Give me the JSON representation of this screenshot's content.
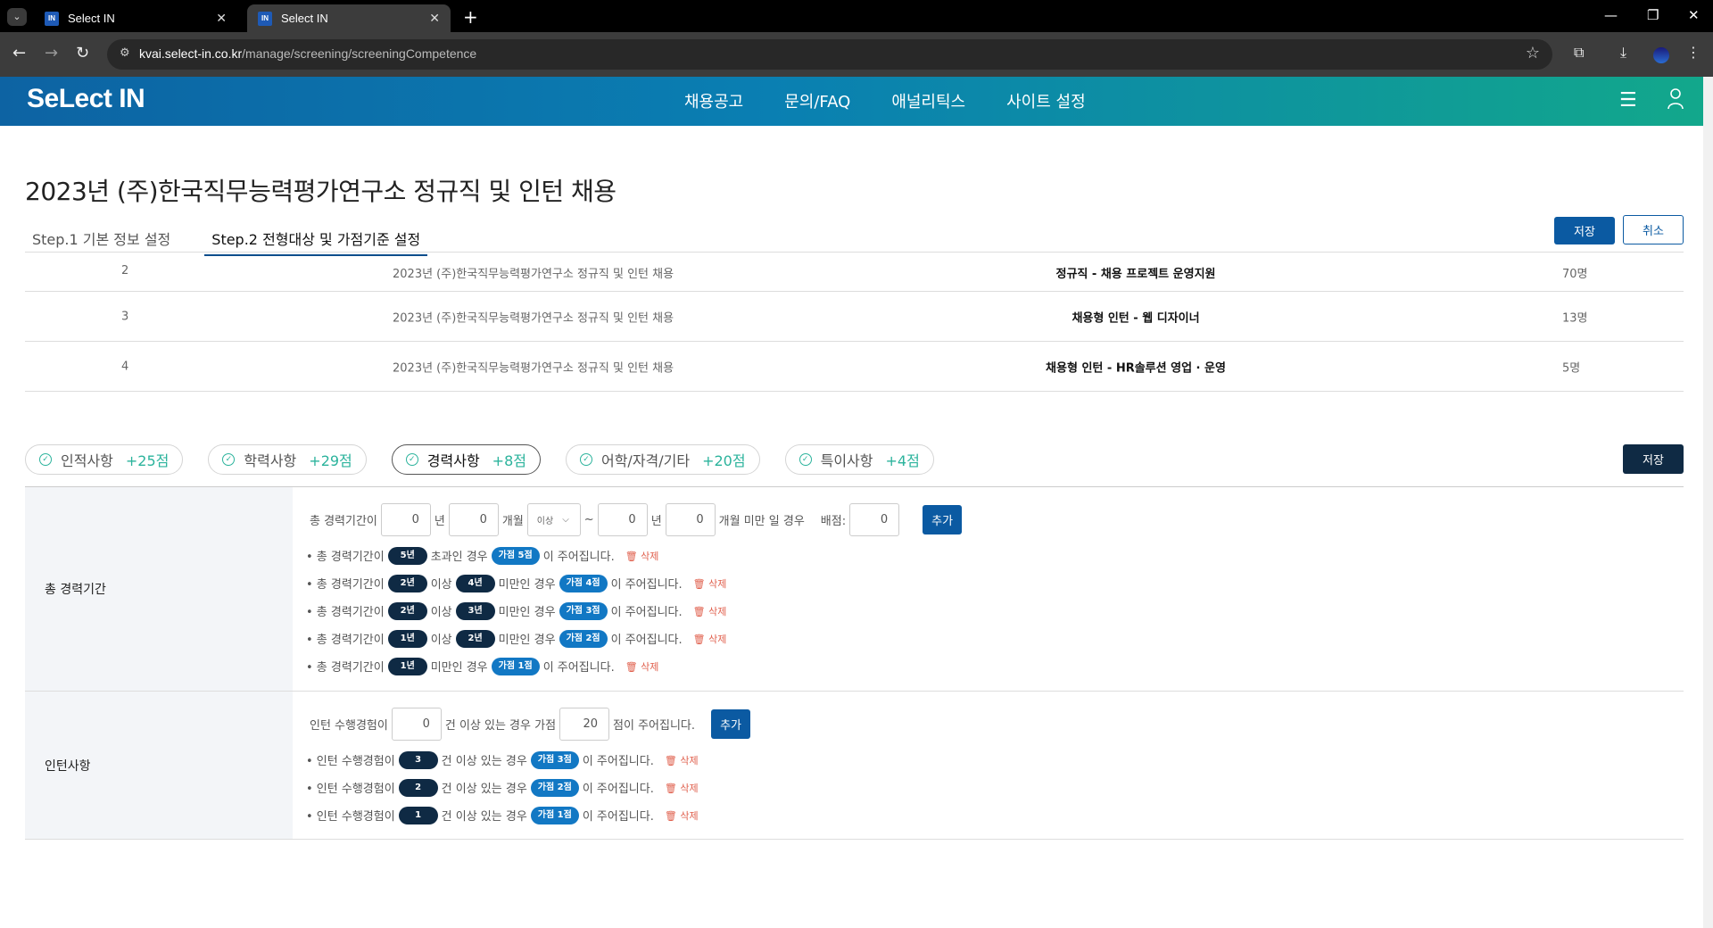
{
  "browser": {
    "tabs": [
      {
        "title": "Select IN",
        "favicon": "IN"
      },
      {
        "title": "Select IN",
        "favicon": "IN"
      }
    ],
    "url_host": "kvai.select-in.co.kr",
    "url_path": "/manage/screening/screeningCompetence"
  },
  "header": {
    "logo": "SeLect IN",
    "nav": [
      "채용공고",
      "문의/FAQ",
      "애널리틱스",
      "사이트 설정"
    ]
  },
  "page": {
    "title": "2023년 (주)한국직무능력평가연구소 정규직 및 인턴 채용",
    "steps": [
      "Step.1 기본 정보 설정",
      "Step.2 전형대상 및 가점기준 설정"
    ],
    "save_label": "저장",
    "cancel_label": "취소"
  },
  "recruit_rows": [
    {
      "num": "2",
      "title": "2023년 (주)한국직무능력평가연구소 정규직 및 인턴 채용",
      "position": "정규직 - 채용 프로젝트 운영지원",
      "count": "70명"
    },
    {
      "num": "3",
      "title": "2023년 (주)한국직무능력평가연구소 정규직 및 인턴 채용",
      "position": "채용형 인턴 - 웹 디자이너",
      "count": "13명"
    },
    {
      "num": "4",
      "title": "2023년 (주)한국직무능력평가연구소 정규직 및 인턴 채용",
      "position": "채용형 인턴 - HR솔루션 영업 · 운영",
      "count": "5명"
    }
  ],
  "categories": [
    {
      "label": "인적사항",
      "score": "+25점"
    },
    {
      "label": "학력사항",
      "score": "+29점"
    },
    {
      "label": "경력사항",
      "score": "+8점"
    },
    {
      "label": "어학/자격/기타",
      "score": "+20점"
    },
    {
      "label": "특이사항",
      "score": "+4점"
    }
  ],
  "save_mid": "저장",
  "career": {
    "head": "총 경력기간",
    "form": {
      "prefix": "총 경력기간이",
      "v1": "0",
      "unit_year": "년",
      "v2": "0",
      "unit_month": "개월",
      "op": "이상",
      "tilde": "~",
      "v3": "0",
      "v4": "0",
      "suffix": "개월 미만 일 경우",
      "score_label": "배점:",
      "score": "0",
      "add": "추가"
    },
    "rules": [
      {
        "pre": "• 총 경력기간이",
        "a": "5년",
        "mid": "초과인 경우",
        "b": "",
        "mid2": "",
        "bonus": "가점 5점",
        "post": "이 주어집니다.",
        "del": "🗑 삭제"
      },
      {
        "pre": "• 총 경력기간이",
        "a": "2년",
        "mid": "이상",
        "b": "4년",
        "mid2": "미만인 경우",
        "bonus": "가점 4점",
        "post": "이 주어집니다.",
        "del": "🗑 삭제"
      },
      {
        "pre": "• 총 경력기간이",
        "a": "2년",
        "mid": "이상",
        "b": "3년",
        "mid2": "미만인 경우",
        "bonus": "가점 3점",
        "post": "이 주어집니다.",
        "del": "🗑 삭제"
      },
      {
        "pre": "• 총 경력기간이",
        "a": "1년",
        "mid": "이상",
        "b": "2년",
        "mid2": "미만인 경우",
        "bonus": "가점 2점",
        "post": "이 주어집니다.",
        "del": "🗑 삭제"
      },
      {
        "pre": "• 총 경력기간이",
        "a": "1년",
        "mid": "미만인 경우",
        "b": "",
        "mid2": "",
        "bonus": "가점 1점",
        "post": "이 주어집니다.",
        "del": "🗑 삭제"
      }
    ]
  },
  "intern": {
    "head": "인턴사항",
    "form": {
      "prefix": "인턴 수행경험이",
      "count": "0",
      "mid": "건 이상 있는 경우 가점",
      "score": "20",
      "suffix": "점이 주어집니다.",
      "add": "추가"
    },
    "rules": [
      {
        "pre": "• 인턴 수행경험이",
        "a": "3",
        "mid": "건 이상 있는 경우",
        "bonus": "가점 3점",
        "post": "이 주어집니다.",
        "del": "🗑 삭제"
      },
      {
        "pre": "• 인턴 수행경험이",
        "a": "2",
        "mid": "건 이상 있는 경우",
        "bonus": "가점 2점",
        "post": "이 주어집니다.",
        "del": "🗑 삭제"
      },
      {
        "pre": "• 인턴 수행경험이",
        "a": "1",
        "mid": "건 이상 있는 경우",
        "bonus": "가점 1점",
        "post": "이 주어집니다.",
        "del": "🗑 삭제"
      }
    ]
  },
  "colors": {
    "accent": "#0b5aa2",
    "navy": "#0f2a44",
    "score_green": "#2bb39c",
    "delete_red": "#e0604d"
  }
}
